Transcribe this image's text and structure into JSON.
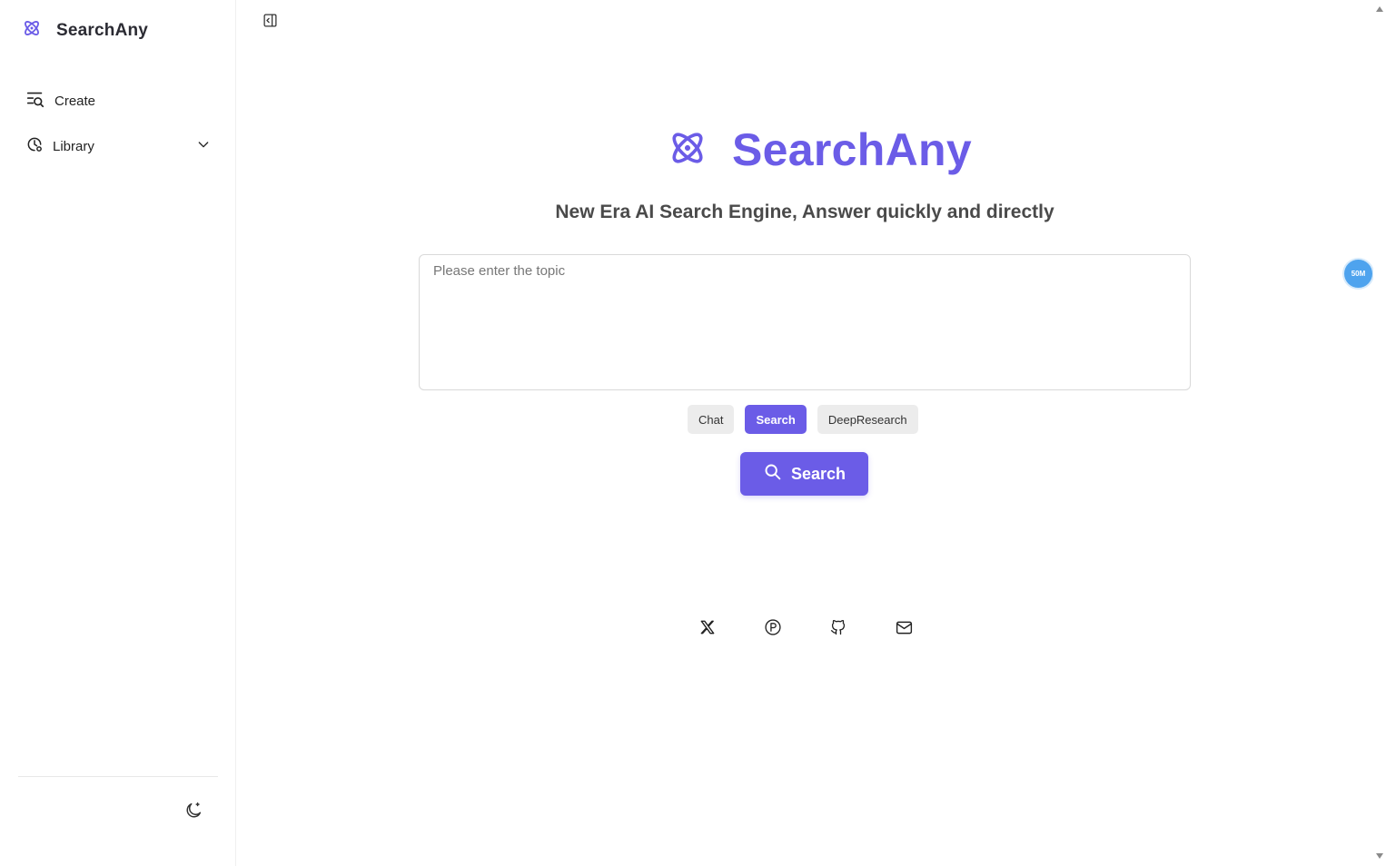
{
  "sidebar": {
    "brand_name": "SearchAny",
    "items": [
      {
        "label": "Create",
        "icon": "create-search-icon"
      },
      {
        "label": "Library",
        "icon": "history-icon",
        "expandable": true
      }
    ],
    "theme_icon": "moon-icon"
  },
  "main": {
    "hero_title": "SearchAny",
    "tagline": "New Era AI Search Engine, Answer quickly and directly",
    "input": {
      "placeholder": "Please enter the topic",
      "value": ""
    },
    "modes": [
      {
        "label": "Chat",
        "active": false
      },
      {
        "label": "Search",
        "active": true
      },
      {
        "label": "DeepResearch",
        "active": false
      }
    ],
    "search_button": "Search",
    "socials": [
      "x-icon",
      "producthunt-icon",
      "github-icon",
      "mail-icon"
    ],
    "floating_badge": "50M"
  },
  "colors": {
    "accent": "#6b5ce7",
    "badge": "#4ea3ee"
  }
}
